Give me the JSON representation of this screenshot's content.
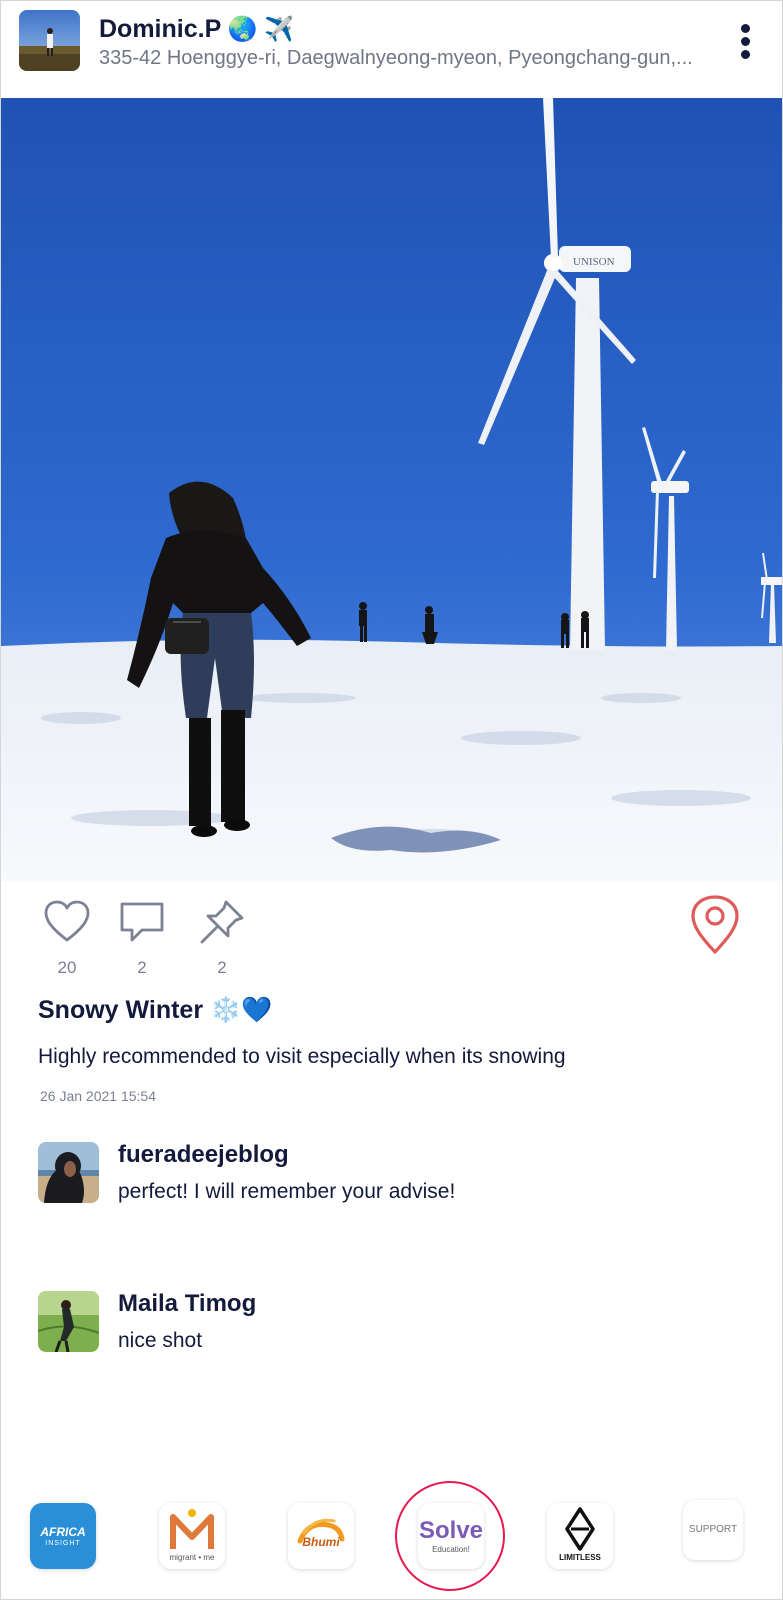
{
  "post": {
    "author": "Dominic.P",
    "author_emojis": "🌏 ✈️",
    "location": "335-42 Hoenggye-ri, Daegwalnyeong-myeon, Pyeongchang-gun,...",
    "title": "Snowy Winter",
    "title_emojis": "❄️💙",
    "text": "Highly recommended to visit especially when its snowing",
    "timestamp": "26 Jan 2021 15:54",
    "photo_turbine_brand": "UNISON"
  },
  "actions": {
    "likes": "20",
    "comments": "2",
    "pins": "2"
  },
  "comments": [
    {
      "name": "fueradeejeblog",
      "text": "perfect! I will remember your advise!"
    },
    {
      "name": "Maila Timog",
      "text": "nice shot"
    }
  ],
  "dock": {
    "africa_top": "AFRICA",
    "africa_bottom": "INSIGHT",
    "migrant_label": "migrant • me",
    "bhumi_label": "Bhumi",
    "solve_label": "Solve",
    "solve_sub": "Education!",
    "limitless_label": "LIMITLESS",
    "support_label": "SUPPORT",
    "highlight_color": "#e8194c"
  },
  "colors": {
    "text_primary": "#141a3c",
    "text_secondary": "#7a8094",
    "location_pin": "#e05a5a",
    "sky": "#2a63c2"
  }
}
